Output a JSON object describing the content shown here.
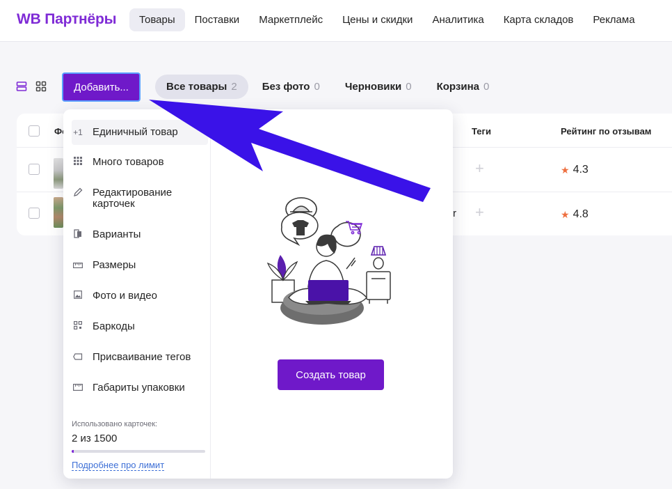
{
  "app": {
    "logo": "WB Партнёры"
  },
  "nav": [
    "Товары",
    "Поставки",
    "Маркетплейс",
    "Цены и скидки",
    "Аналитика",
    "Карта складов",
    "Реклама"
  ],
  "toolbar": {
    "add_label": "Добавить...",
    "filters": [
      {
        "label": "Все товары",
        "count": "2"
      },
      {
        "label": "Без фото",
        "count": "0"
      },
      {
        "label": "Черновики",
        "count": "0"
      },
      {
        "label": "Корзина",
        "count": "0"
      }
    ]
  },
  "table": {
    "col_photo_partial": "Фо",
    "col_tags": "Теги",
    "col_rating": "Рейтинг по отзывам",
    "rows": [
      {
        "rating": "4.3"
      },
      {
        "rating": "4.8",
        "partial": "r"
      }
    ]
  },
  "menu": {
    "items": [
      {
        "icon": "+1",
        "label": "Единичный товар"
      },
      {
        "icon": "grid-icon",
        "label": "Много товаров"
      },
      {
        "icon": "pencil-icon",
        "label": "Редактирование карточек"
      },
      {
        "icon": "variants-icon",
        "label": "Варианты"
      },
      {
        "icon": "ruler-icon",
        "label": "Размеры"
      },
      {
        "icon": "image-icon",
        "label": "Фото и видео"
      },
      {
        "icon": "qr-icon",
        "label": "Баркоды"
      },
      {
        "icon": "tag-icon",
        "label": "Присваивание тегов"
      },
      {
        "icon": "box-ruler-icon",
        "label": "Габариты упаковки"
      }
    ],
    "usage_caption": "Использовано карточек:",
    "usage_value": "2 из 1500",
    "usage_fraction": 0.0013,
    "usage_link": "Подробнее про лимит"
  },
  "panel": {
    "create_label": "Создать товар"
  },
  "colors": {
    "brand": "#7f2bd6",
    "button": "#6f19c9",
    "arrow": "#3a12e8",
    "star": "#ee6f3f",
    "link": "#3d6fd6"
  }
}
